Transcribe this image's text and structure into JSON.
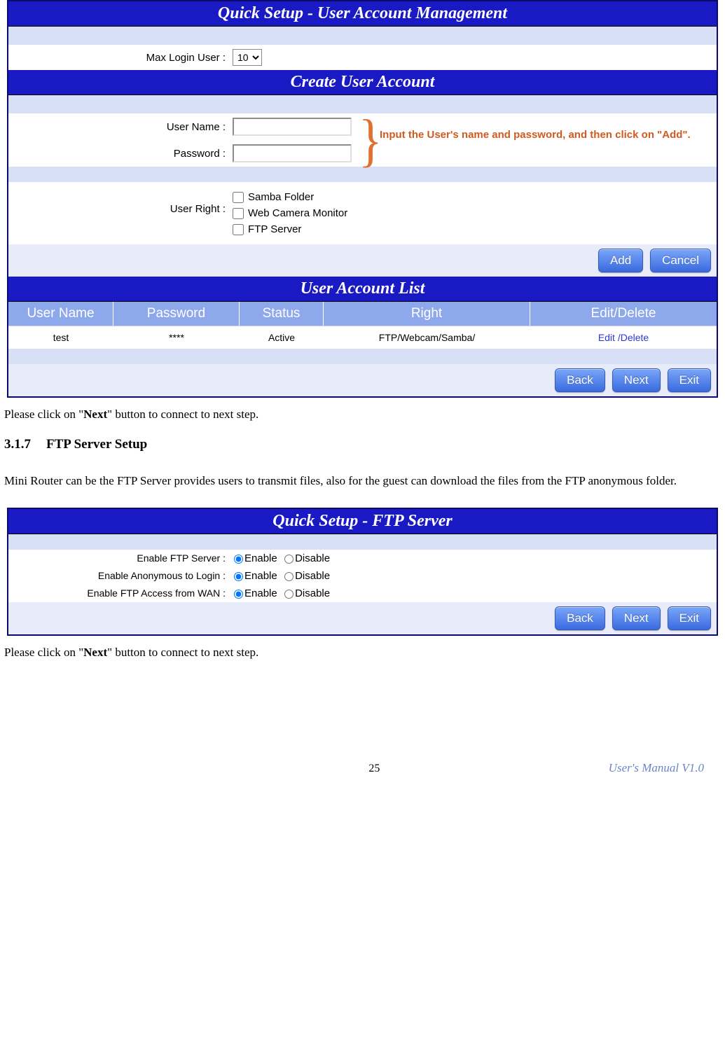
{
  "panel1": {
    "title": "Quick Setup - User Account Management",
    "maxlogin_label": "Max Login User :",
    "maxlogin_value": "10",
    "create_title": "Create User Account",
    "username_label": "User Name :",
    "password_label": "Password :",
    "callout": "Input the User's name and password, and then click on \"Add\".",
    "userright_label": "User Right :",
    "right_samba": "Samba Folder",
    "right_webcam": "Web Camera Monitor",
    "right_ftp": "FTP Server",
    "btn_add": "Add",
    "btn_cancel": "Cancel",
    "list_title": "User Account List",
    "cols": {
      "user": "User Name",
      "pass": "Password",
      "status": "Status",
      "right": "Right",
      "ed": "Edit/Delete"
    },
    "rows": [
      {
        "user": "test",
        "pass": "****",
        "status": "Active",
        "right": "FTP/Webcam/Samba/",
        "edit": "Edit",
        "del": "Delete"
      }
    ],
    "btn_back": "Back",
    "btn_next": "Next",
    "btn_exit": "Exit"
  },
  "doc1": {
    "pre": "Please click on \"",
    "bold": "Next",
    "post": "\" button to connect to next step."
  },
  "section": {
    "num": "3.1.7",
    "title": "FTP Server Setup"
  },
  "para1": "Mini Router can be the FTP Server provides users to transmit files, also for the guest can download the files from the FTP anonymous folder.",
  "panel2": {
    "title": "Quick Setup - FTP Server",
    "r1": "Enable FTP Server :",
    "r2": "Enable Anonymous to Login :",
    "r3": "Enable FTP Access from WAN :",
    "opt_en": "Enable",
    "opt_dis": "Disable",
    "btn_back": "Back",
    "btn_next": "Next",
    "btn_exit": "Exit"
  },
  "doc2": {
    "pre": "Please click on \"",
    "bold": "Next",
    "post": "\" button to connect to next step."
  },
  "footer": {
    "page": "25",
    "right": "User's Manual V1.0"
  }
}
